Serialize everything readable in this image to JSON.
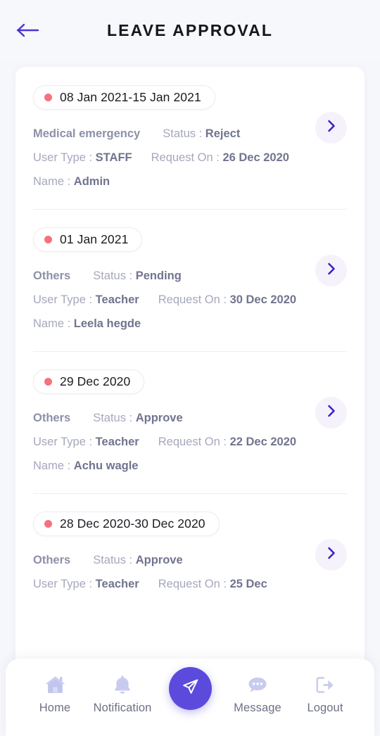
{
  "header": {
    "title": "LEAVE APPROVAL",
    "back_icon": "arrow-left-icon",
    "back_color": "#4b33d6"
  },
  "theme": {
    "page_bg": "#f6f7fb",
    "card_bg": "#ffffff",
    "accent": "#5b4bdd",
    "dot": "#f5717e",
    "label": "#a6a8bd",
    "value": "#71748f",
    "chevron_bg": "#f5f2fc",
    "nav_icon": "#c4c8ee"
  },
  "labels": {
    "status": "Status :",
    "user_type": "User Type :",
    "request_on": "Request On :",
    "name": "Name :"
  },
  "leave_requests": [
    {
      "date_range": "08 Jan 2021-15 Jan 2021",
      "reason": "Medical emergency",
      "status": "Reject",
      "user_type": "STAFF",
      "request_on": "26 Dec 2020",
      "name": "Admin"
    },
    {
      "date_range": "01 Jan 2021",
      "reason": "Others",
      "status": "Pending",
      "user_type": "Teacher",
      "request_on": "30 Dec 2020",
      "name": "Leela hegde"
    },
    {
      "date_range": "29 Dec 2020",
      "reason": "Others",
      "status": "Approve",
      "user_type": "Teacher",
      "request_on": "22 Dec 2020",
      "name": "Achu wagle"
    },
    {
      "date_range": "28 Dec 2020-30 Dec 2020",
      "reason": "Others",
      "status": "Approve",
      "user_type": "Teacher",
      "request_on": "25 Dec",
      "name": ""
    }
  ],
  "bottom_nav": {
    "items": [
      {
        "label": "Home",
        "icon": "home-icon"
      },
      {
        "label": "Notification",
        "icon": "bell-icon"
      },
      {
        "label": "Message",
        "icon": "message-bubble-icon"
      },
      {
        "label": "Logout",
        "icon": "logout-icon"
      }
    ],
    "fab": {
      "icon": "send-plane-icon",
      "color": "#5b4bdd"
    }
  }
}
